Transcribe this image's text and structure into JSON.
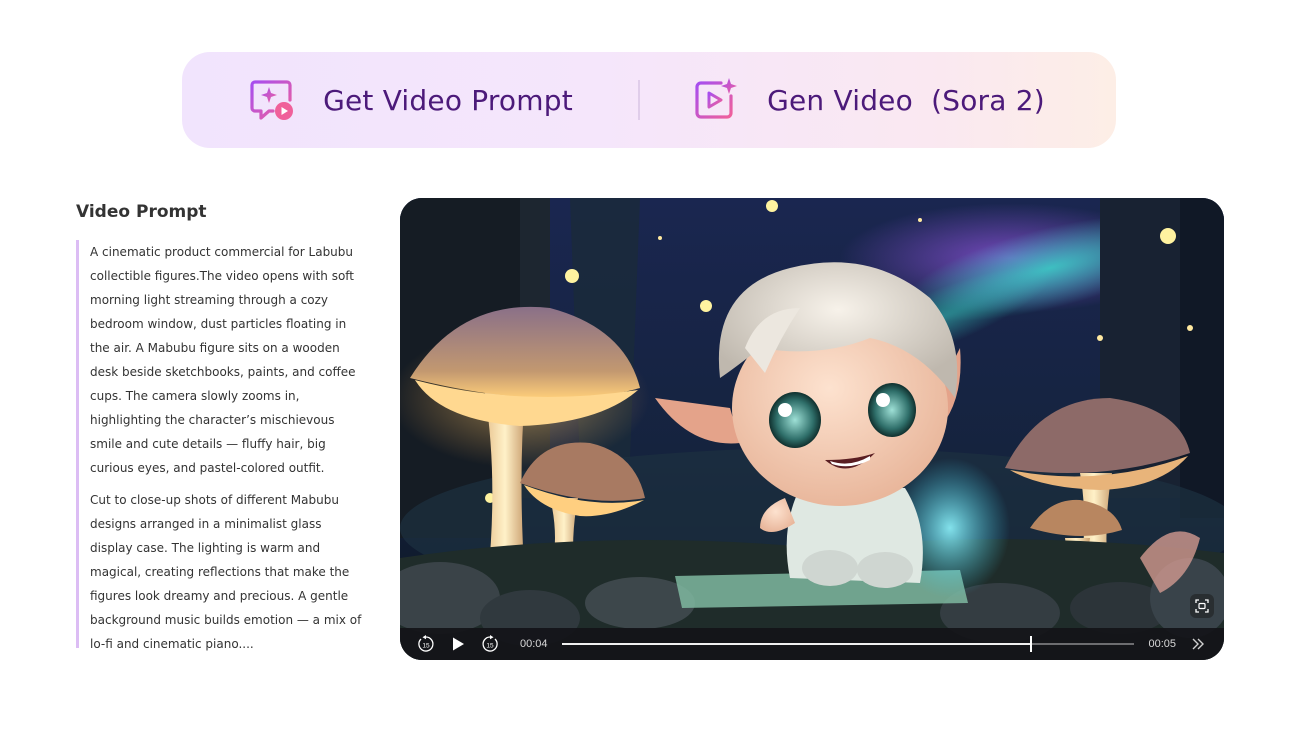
{
  "tabs": [
    {
      "label": "Get Video Prompt",
      "icon": "chat-play-sparkle-icon"
    },
    {
      "label": "Gen Video  (Sora 2)",
      "icon": "video-sparkle-icon"
    }
  ],
  "prompt": {
    "title": "Video Prompt",
    "paragraphs": [
      "A cinematic product commercial for Labubu collectible figures.The video opens with soft morning light streaming through a cozy bedroom window, dust particles floating in the air. A Mabubu figure sits on a wooden desk beside sketchbooks, paints, and coffee cups. The camera slowly zooms in, highlighting the character’s mischievous smile and cute details — fluffy hair, big curious eyes, and pastel-colored outfit.",
      "Cut to close-up shots of different Mabubu designs arranged in a minimalist glass display case. The lighting is warm and magical, creating reflections that make the figures look dreamy and precious. A gentle background music builds emotion — a mix of lo-fi and cinematic piano...."
    ]
  },
  "player": {
    "current_time": "00:04",
    "duration": "00:05",
    "progress": 0.82,
    "controls": {
      "rewind_icon": "rewind-15-icon",
      "play_icon": "play-icon",
      "forward_icon": "forward-15-icon",
      "speed_icon": "double-chevron-right-icon",
      "screenshot_icon": "screenshot-icon"
    }
  },
  "colors": {
    "tab_text": "#4c1a7a",
    "accent_purple": "#a64ef0",
    "accent_pink": "#f0609a",
    "prompt_bar": "#dcbdf4"
  }
}
